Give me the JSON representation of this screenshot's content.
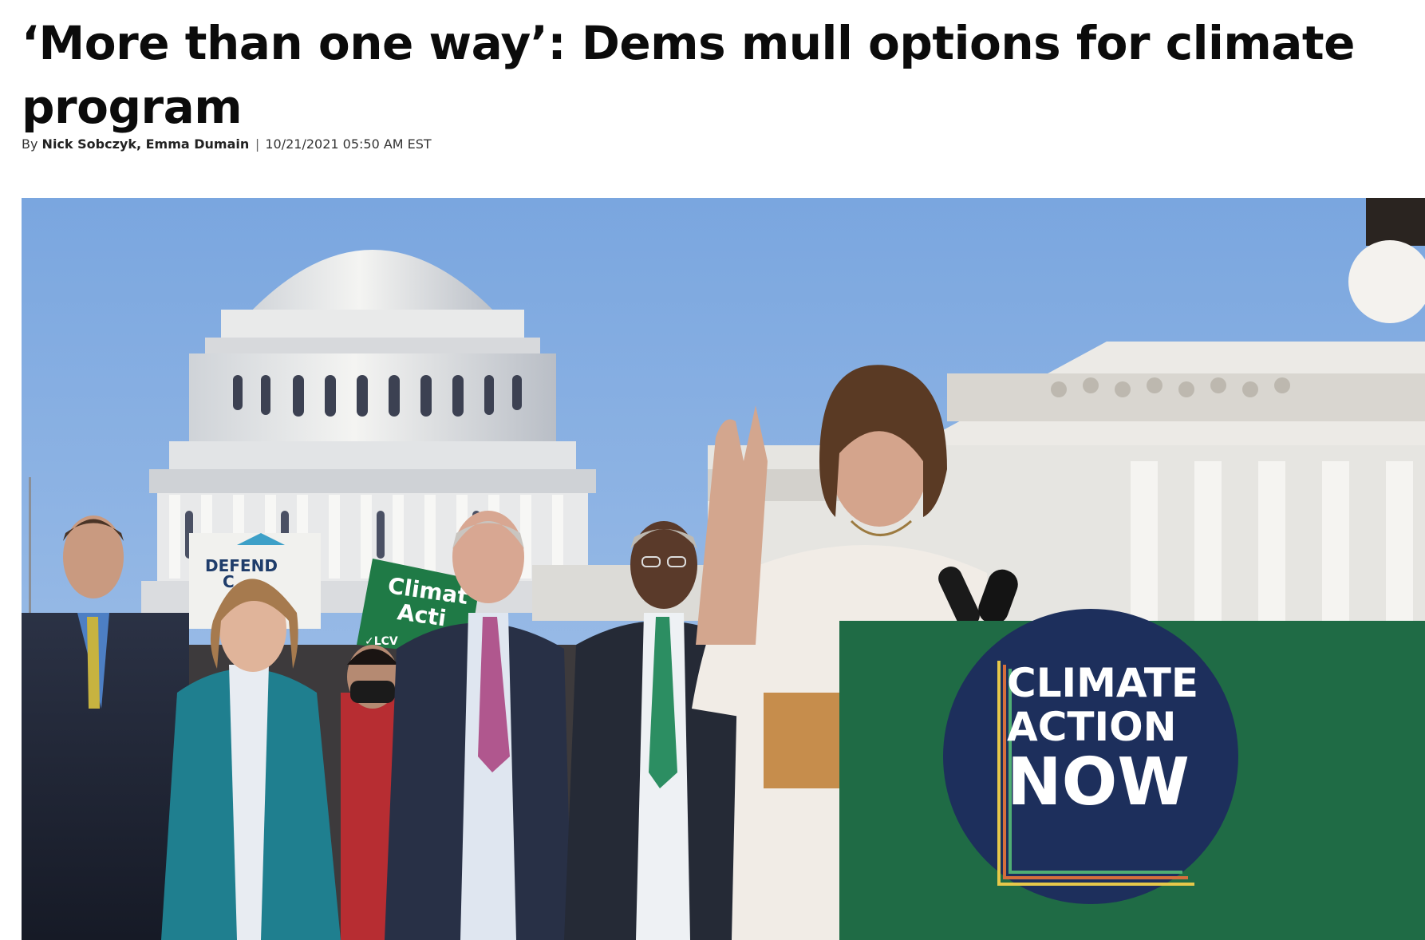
{
  "article": {
    "headline": "‘More than one way’: Dems mull options for climate program",
    "byline": {
      "prefix": "By",
      "authors": [
        "Nick Sobczyk",
        "Emma Dumain"
      ],
      "author_separator": ", ",
      "divider": "|",
      "timestamp": "10/21/2021 05:50 AM EST"
    }
  },
  "hero_image": {
    "description_icon": "photo",
    "signs": {
      "podium_line1": "CLIMATE",
      "podium_line2": "ACTION",
      "podium_line3": "NOW",
      "green_sign_line1": "Climat",
      "green_sign_line2": "Acti",
      "green_sign_tag": "✓LCV",
      "white_sign_line1": "DEFEND",
      "white_sign_line2": "C"
    },
    "colors": {
      "sky": "#86acdf",
      "podium_green": "#1f6b45",
      "podium_circle": "#1d2f5c",
      "sign_green": "#1f7a46"
    }
  }
}
